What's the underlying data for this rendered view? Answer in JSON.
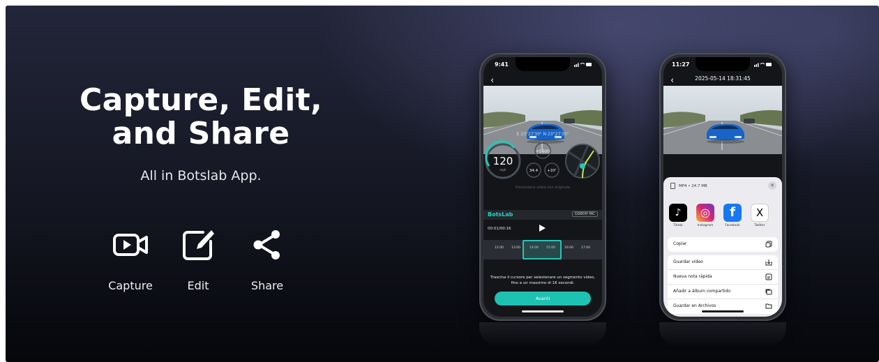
{
  "headline": [
    "Capture, Edit,",
    "and Share"
  ],
  "subline": "All in Botslab App.",
  "features": [
    {
      "label": "Capture",
      "icon": "video-camera-icon"
    },
    {
      "label": "Edit",
      "icon": "edit-icon"
    },
    {
      "label": "Share",
      "icon": "share-icon"
    }
  ],
  "phone1": {
    "time": "9:41",
    "coords": "E 23°27'30\" N 23°27'30\"",
    "speed": "120",
    "speed_unit": "mph",
    "rpm": "+5600",
    "val_a": "34.4",
    "val_b": "+10°",
    "source_note": "Risoluzione video non originale",
    "brand": "BotsLab",
    "model": "G980H MC",
    "timer": "00:01/00:16",
    "timeline_labels": [
      "12:00",
      "13:00",
      "14:00",
      "15:00",
      "16:00",
      "17:00"
    ],
    "hint": "Trascina il cursore per selezionare un segmento video, fino a un massimo di 16 secondi.",
    "cta": "Avanti"
  },
  "phone2": {
    "time": "11:27",
    "title": "2025-05-14 18:31:45",
    "file_info": "MP4 • 24.7 MB",
    "apps": [
      {
        "name": "Tiktok",
        "color": "#000000",
        "glyph": "♪"
      },
      {
        "name": "Instagram",
        "color": "#d6286f",
        "glyph": "◎"
      },
      {
        "name": "Facebook",
        "color": "#1877f2",
        "glyph": "f"
      },
      {
        "name": "Twitter",
        "color": "#000000",
        "glyph": "X"
      }
    ],
    "copy": "Copiar",
    "actions": [
      "Guardar vídeo",
      "Nueva nota rápida",
      "Añadir a álbum compartido",
      "Guardar en Archivos"
    ]
  },
  "colors": {
    "accent": "#1ec2b2",
    "brand_teal": "#2ad1c0"
  }
}
